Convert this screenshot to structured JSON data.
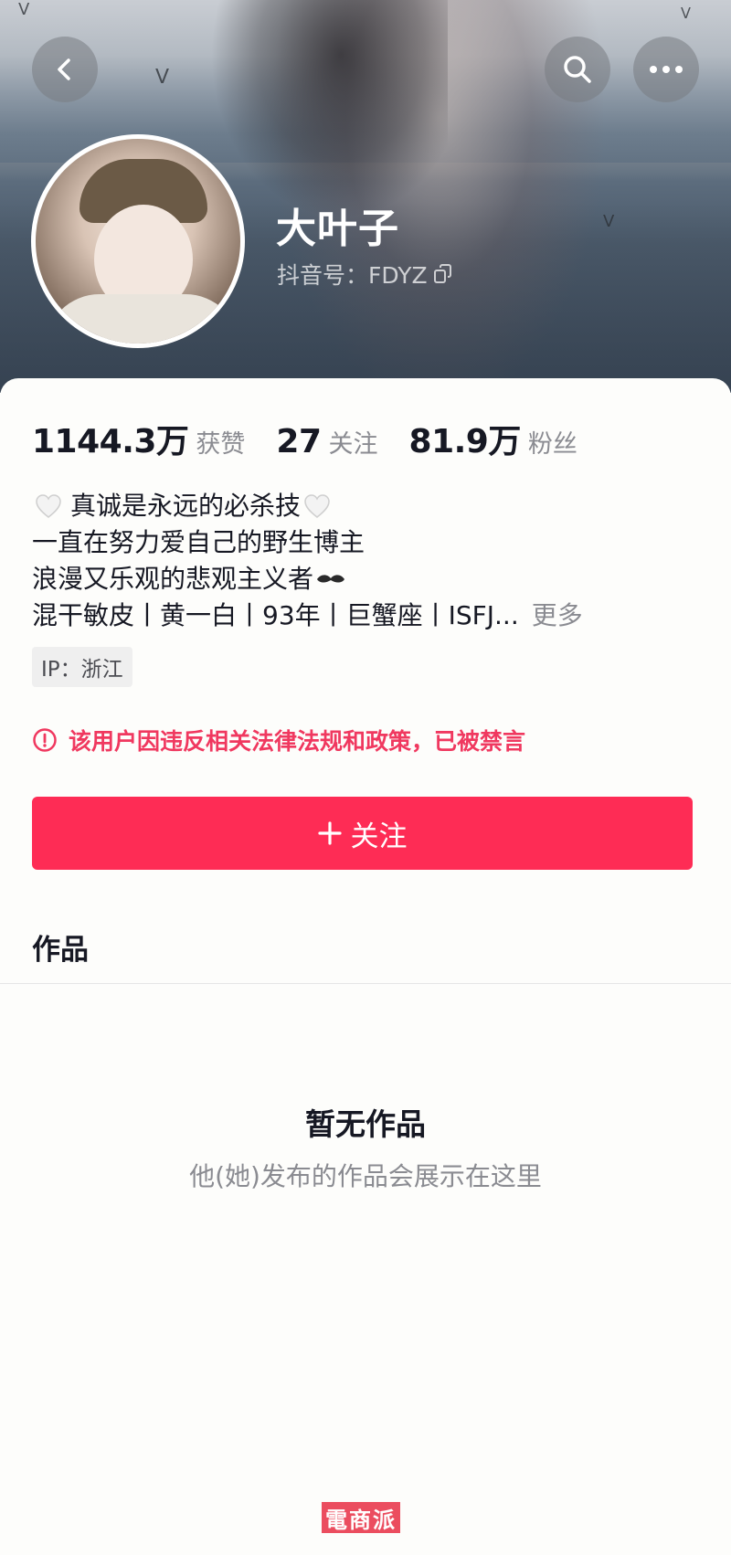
{
  "profile": {
    "name": "大叶子",
    "id_label": "抖音号：FDYZ"
  },
  "stats": [
    {
      "value": "1144.3万",
      "label": "获赞"
    },
    {
      "value": "27",
      "label": "关注"
    },
    {
      "value": "81.9万",
      "label": "粉丝"
    }
  ],
  "bio": {
    "line1": "真诚是永远的必杀技",
    "line2": "一直在努力爱自己的野生博主",
    "line3": "浪漫又乐观的悲观主义者",
    "line4": "混干敏皮丨黄一白丨93年丨巨蟹座丨ISFJ...",
    "more": "更多"
  },
  "ip": "IP：浙江",
  "warning": "该用户因违反相关法律法规和政策，已被禁言",
  "follow_button": "关注",
  "tabs": {
    "works": "作品"
  },
  "empty": {
    "title": "暂无作品",
    "subtitle": "他(她)发布的作品会展示在这里"
  },
  "watermark": "電商派",
  "icons": {
    "back": "chevron-left-icon",
    "search": "search-icon",
    "more": "more-dots-icon",
    "copy": "copy-icon",
    "warning": "alert-circle-icon",
    "plus": "plus-icon",
    "heart": "white-heart-icon",
    "mustache": "mustache-icon"
  },
  "colors": {
    "accent": "#fe2c55",
    "warning": "#f0385f",
    "muted": "#8a8b91"
  }
}
